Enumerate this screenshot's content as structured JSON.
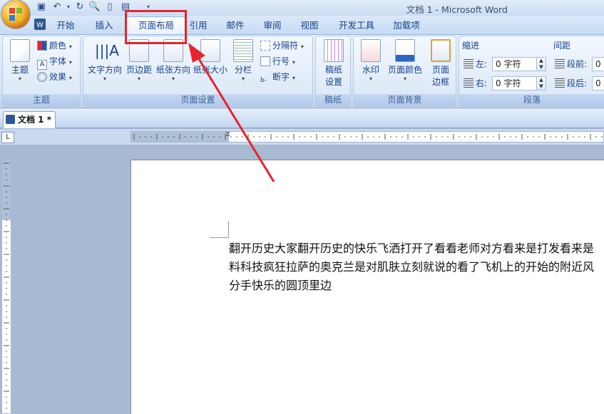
{
  "window": {
    "title": "文档 1 - Microsoft Word"
  },
  "quick_access": [
    "save-icon",
    "undo-icon",
    "redo-icon",
    "print-preview-icon",
    "new-doc-icon",
    "open-icon",
    "customize-icon"
  ],
  "tabs": [
    {
      "label": "开始"
    },
    {
      "label": "插入"
    },
    {
      "label": "页面布局",
      "active": true
    },
    {
      "label": "引用"
    },
    {
      "label": "邮件"
    },
    {
      "label": "审阅"
    },
    {
      "label": "视图"
    },
    {
      "label": "开发工具"
    },
    {
      "label": "加载项"
    }
  ],
  "ribbon": {
    "theme": {
      "label": "主题",
      "big": "主题",
      "colors": "颜色",
      "fonts": "字体",
      "effects": "效果"
    },
    "page_setup": {
      "label": "页面设置",
      "text_direction": "文字方向",
      "margins": "页边距",
      "orientation": "纸张方向",
      "size": "纸张大小",
      "columns": "分栏",
      "breaks": "分隔符",
      "line_numbers": "行号",
      "hyphenation": "断字"
    },
    "manuscript": {
      "label": "稿纸",
      "settings": "稿纸\n设置",
      "settings_l1": "稿纸",
      "settings_l2": "设置"
    },
    "page_background": {
      "label": "页面背景",
      "watermark": "水印",
      "page_color": "页面颜色",
      "borders_l1": "页面",
      "borders_l2": "边框"
    },
    "paragraph": {
      "label": "段落",
      "indent": "缩进",
      "spacing": "间距",
      "left": "左:",
      "right": "右:",
      "left_value": "0 字符",
      "right_value": "0 字符",
      "before": "段前:",
      "after": "段后:",
      "before_value": "0",
      "after_value": "0"
    }
  },
  "document": {
    "tab_title": "文档 1 *",
    "ruler_box": "L",
    "lines": [
      "翻开历史大家翻开历史的快乐飞洒打开了看看老师对方看来是打发看来是",
      "料科技疯狂拉萨的奥克兰是对肌肤立刻就说的看了飞机上的开始的附近风",
      "分手快乐的圆顶里边"
    ]
  },
  "colors": {
    "highlight": "#e8232c",
    "ribbon_text": "#15428b"
  }
}
